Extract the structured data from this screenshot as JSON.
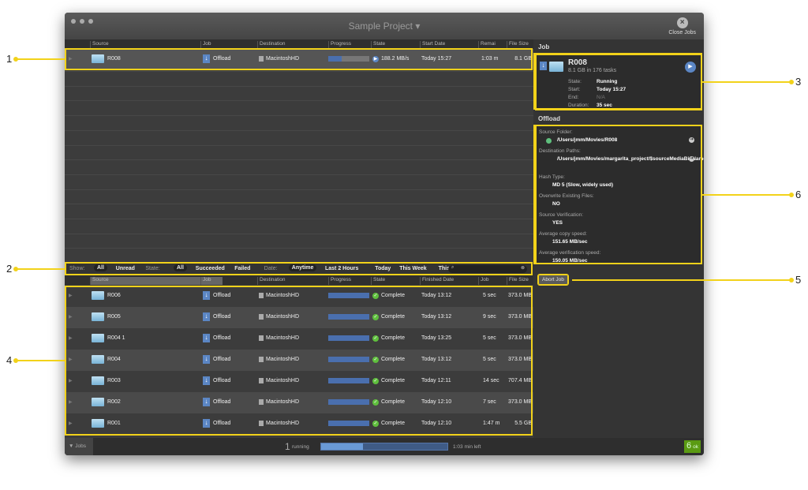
{
  "window": {
    "title": "Sample Project",
    "close_jobs": "Close Jobs"
  },
  "columns_running": [
    "Source",
    "Job",
    "Destination",
    "Progress",
    "State",
    "Start Date",
    "Remai",
    "File Size"
  ],
  "running": {
    "source": "R008",
    "job": "Offload",
    "destination": "MacintoshHD",
    "progress": 0.33,
    "state": "188.2 MB/s",
    "start": "Today 15:27",
    "remaining": "1:03 m",
    "size": "8.1 GB"
  },
  "filter": {
    "show_label": "Show:",
    "show": [
      "All",
      "Unread"
    ],
    "state_label": "State:",
    "state": [
      "All",
      "Succeeded",
      "Failed"
    ],
    "date_label": "Date:",
    "date": [
      "Anytime",
      "Last 2 Hours",
      "Today",
      "This Week",
      "This Month"
    ],
    "search_placeholder": ""
  },
  "columns_finished": [
    "Source",
    "Job",
    "Destination",
    "Progress",
    "State",
    "Finished Date",
    "Job",
    "File Size"
  ],
  "finished": [
    {
      "source": "R006",
      "job": "Offload",
      "destination": "MacintoshHD",
      "state": "Complete",
      "finished": "Today 13:12",
      "duration": "5 sec",
      "size": "373.0 MB"
    },
    {
      "source": "R005",
      "job": "Offload",
      "destination": "MacintoshHD",
      "state": "Complete",
      "finished": "Today 13:12",
      "duration": "9 sec",
      "size": "373.0 MB"
    },
    {
      "source": "R004 1",
      "job": "Offload",
      "destination": "MacintoshHD",
      "state": "Complete",
      "finished": "Today 13:25",
      "duration": "5 sec",
      "size": "373.0 MB"
    },
    {
      "source": "R004",
      "job": "Offload",
      "destination": "MacintoshHD",
      "state": "Complete",
      "finished": "Today 13:12",
      "duration": "5 sec",
      "size": "373.0 MB"
    },
    {
      "source": "R003",
      "job": "Offload",
      "destination": "MacintoshHD",
      "state": "Complete",
      "finished": "Today 12:11",
      "duration": "14 sec",
      "size": "707.4 MB"
    },
    {
      "source": "R002",
      "job": "Offload",
      "destination": "MacintoshHD",
      "state": "Complete",
      "finished": "Today 12:10",
      "duration": "7 sec",
      "size": "373.0 MB"
    },
    {
      "source": "R001",
      "job": "Offload",
      "destination": "MacintoshHD",
      "state": "Complete",
      "finished": "Today 12:10",
      "duration": "1:47 m",
      "size": "5.5 GB"
    }
  ],
  "job_panel": {
    "heading": "Job",
    "name": "R008",
    "summary": "8.1 GB in 176 tasks",
    "state_label": "State:",
    "state": "Running",
    "start_label": "Start:",
    "start": "Today 15:27",
    "end_label": "End:",
    "end": "N/A",
    "duration_label": "Duration:",
    "duration": "35 sec"
  },
  "offload_panel": {
    "heading": "Offload",
    "fields": [
      {
        "label": "Source Folder:",
        "value": "/Users/jmm/Movies/R008"
      },
      {
        "label": "Destination Paths:",
        "value": "/Users/jmm/Movies/margarita_project/$sourceMediaBinName$/$sourceFolderStructure$"
      },
      {
        "label": "Hash Type:",
        "value": "MD 5 (Slow, widely used)"
      },
      {
        "label": "Overwrite Existing Files:",
        "value": "NO"
      },
      {
        "label": "Source Verification:",
        "value": "YES"
      },
      {
        "label": "Average copy speed:",
        "value": "151.65 MB/sec"
      },
      {
        "label": "Average verification speed:",
        "value": "150.05 MB/sec"
      }
    ]
  },
  "abort_button": "Abort Job",
  "statusbar": {
    "jobs": "▼ Jobs",
    "running_count": "1",
    "running_label": "running",
    "progress": 0.33,
    "time_left": "1:03 min left",
    "ok_count": "6",
    "ok_label": "ok"
  },
  "callouts": [
    "1",
    "2",
    "3",
    "4",
    "5",
    "6"
  ],
  "colors": {
    "highlight": "#f2d21a",
    "progress": "#4a6fae",
    "ok": "#5fbf3d"
  }
}
